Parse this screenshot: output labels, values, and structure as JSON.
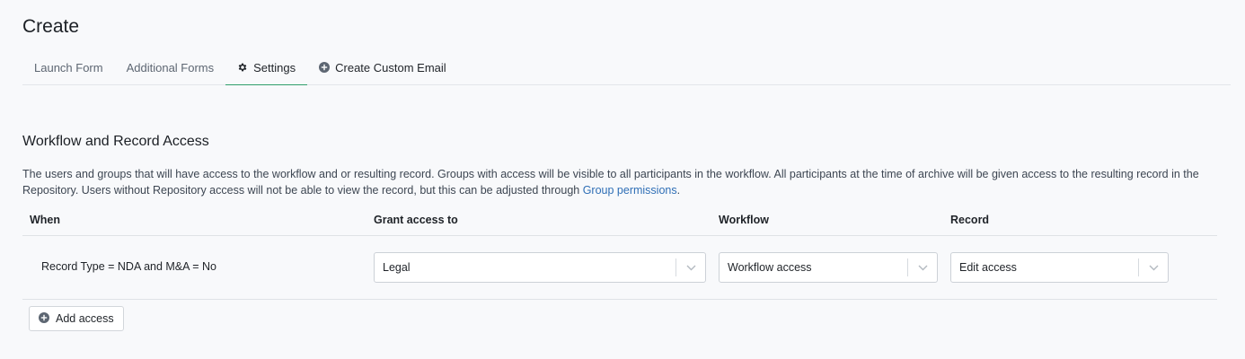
{
  "page": {
    "title": "Create"
  },
  "tabs": [
    {
      "label": "Launch Form",
      "icon": ""
    },
    {
      "label": "Additional Forms",
      "icon": ""
    },
    {
      "label": "Settings",
      "icon": "gear-icon",
      "active": true
    },
    {
      "label": "Create Custom Email",
      "icon": "plus-circle-icon"
    }
  ],
  "access": {
    "title": "Workflow and Record Access",
    "description": "The users and groups that will have access to the workflow and or resulting record. Groups with access will be visible to all participants in the workflow. All participants at the time of archive will be given access to the resulting record in the Repository. Users without Repository access will not be able to view the record, but this can be adjusted through ",
    "description_link": "Group permissions",
    "description_end": ".",
    "columns": {
      "when": "When",
      "grant": "Grant access to",
      "workflow": "Workflow",
      "record": "Record"
    },
    "rows": [
      {
        "when": "Record Type = NDA and M&A = No",
        "grant": "Legal",
        "workflow": "Workflow access",
        "record": "Edit access"
      }
    ],
    "add_label": "Add access"
  },
  "colors": {
    "accent": "#2f9e6b",
    "link": "#2f6fb6"
  }
}
